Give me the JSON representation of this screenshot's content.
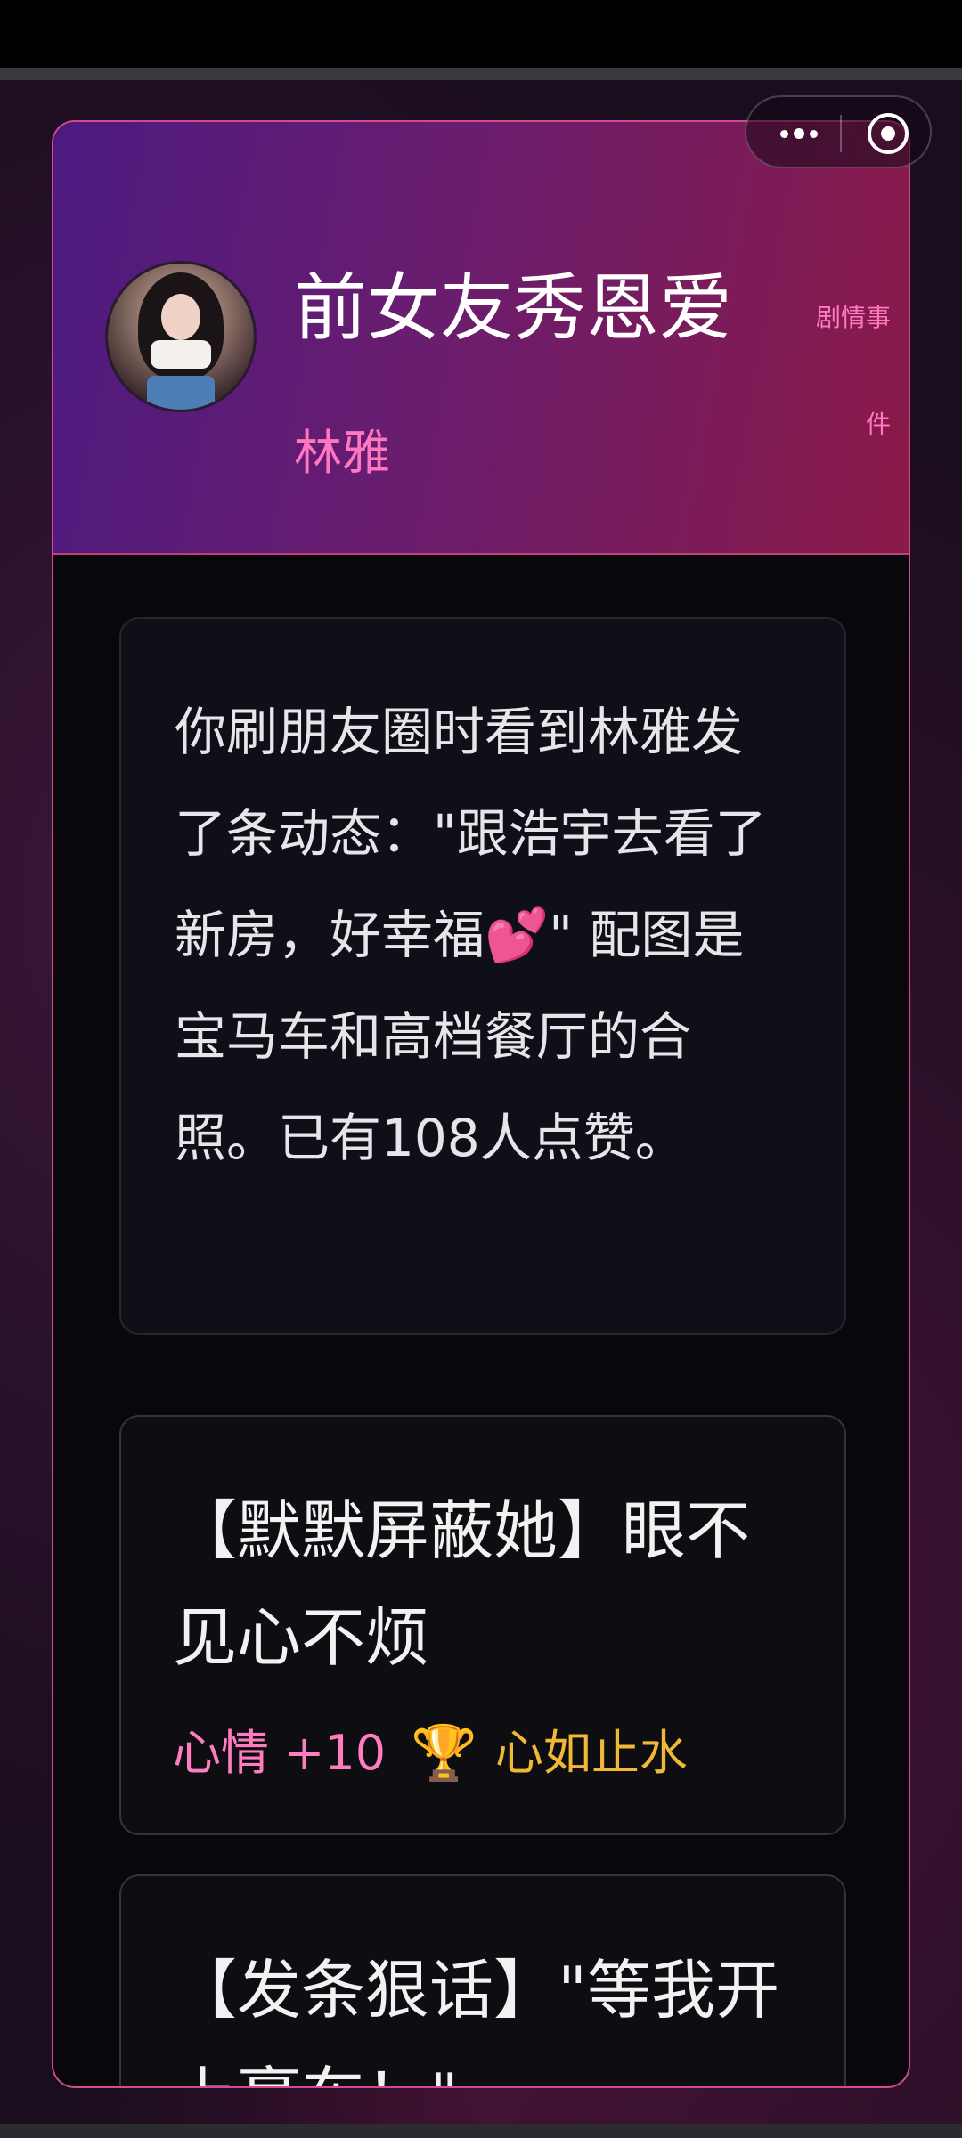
{
  "window": {
    "capsule": {
      "more_icon": "more-dots-icon",
      "close_icon": "target-close-icon"
    }
  },
  "header": {
    "title": "前女友秀恩爱",
    "character": "林雅",
    "tag": "剧情事件"
  },
  "story": {
    "text": "你刷朋友圈时看到林雅发了条动态：\"跟浩宇去看了新房，好幸福💕\" 配图是宝马车和高档餐厅的合照。已有108人点赞。"
  },
  "choices": [
    {
      "text": "【默默屏蔽她】眼不见心不烦",
      "mood": "心情 +10",
      "achievement_icon": "trophy-icon",
      "achievement": "心如止水"
    },
    {
      "text": "【发条狠话】\"等我开上豪车！\""
    }
  ],
  "colors": {
    "accent_pink": "#ff77bf",
    "achievement_gold": "#f0b935",
    "card_border": "#d24a90"
  }
}
